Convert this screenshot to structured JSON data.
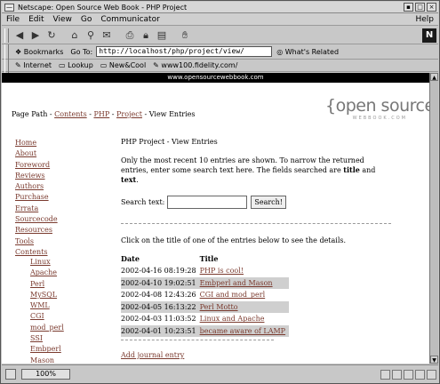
{
  "window": {
    "title": "Netscape: Open Source Web Book - PHP Project"
  },
  "menu": {
    "items": [
      "File",
      "Edit",
      "View",
      "Go",
      "Communicator"
    ],
    "help": "Help"
  },
  "toolbar": {
    "icons": [
      "back-icon",
      "forward-icon",
      "reload-icon",
      "home-icon",
      "search-icon",
      "netscape-icon",
      "print-icon",
      "security-icon",
      "shop-icon",
      "stop-icon"
    ]
  },
  "location": {
    "bookmarks_label": "Bookmarks",
    "goto_label": "Go To:",
    "url": "http://localhost/php/project/view/",
    "related_label": "What's Related"
  },
  "personal": {
    "items": [
      "Internet",
      "Lookup",
      "New&Cool",
      "www100.fidelity.com/"
    ]
  },
  "page": {
    "banner": "www.opensourcewebbook.com",
    "logo_main": "{open source}",
    "logo_sub": "WEBBOOK.COM",
    "path_label": "Page Path -",
    "path": [
      "Contents",
      "PHP",
      "Project"
    ],
    "path_current": "View Entries",
    "sidebar": [
      "Home",
      "About",
      "Foreword",
      "Reviews",
      "Authors",
      "Purchase",
      "Errata",
      "Sourcecode",
      "Resources",
      "Tools",
      "Contents"
    ],
    "subnav": [
      "Linux",
      "Apache",
      "Perl",
      "MySQL",
      "WML",
      "CGI",
      "mod_perl",
      "SSI",
      "Embperl",
      "Mason"
    ],
    "main_title": "PHP Project - View Entries",
    "intro_1": "Only the most recent 10 entries are shown. To narrow the returned entries, enter some search text here. The fields searched are ",
    "intro_title": "title",
    "intro_and": " and ",
    "intro_text": "text",
    "intro_end": ".",
    "search_label": "Search text:",
    "search_value": "",
    "search_button": "Search!",
    "click_text": "Click on the title of one of the entries below to see the details.",
    "table": {
      "headers": [
        "Date",
        "Title"
      ],
      "rows": [
        {
          "date": "2002-04-16 08:19:28",
          "title": "PHP is cool!"
        },
        {
          "date": "2002-04-10 19:02:51",
          "title": "Embperl and Mason"
        },
        {
          "date": "2002-04-08 12:43:26",
          "title": "CGI and mod_perl"
        },
        {
          "date": "2002-04-05 16:13:22",
          "title": "Perl Motto"
        },
        {
          "date": "2002-04-03 11:03:52",
          "title": "Linux and Apache"
        },
        {
          "date": "2002-04-01 10:23:51",
          "title": "became aware of LAMP"
        }
      ]
    },
    "add_link": "Add journal entry"
  },
  "status": {
    "progress": "100%"
  }
}
